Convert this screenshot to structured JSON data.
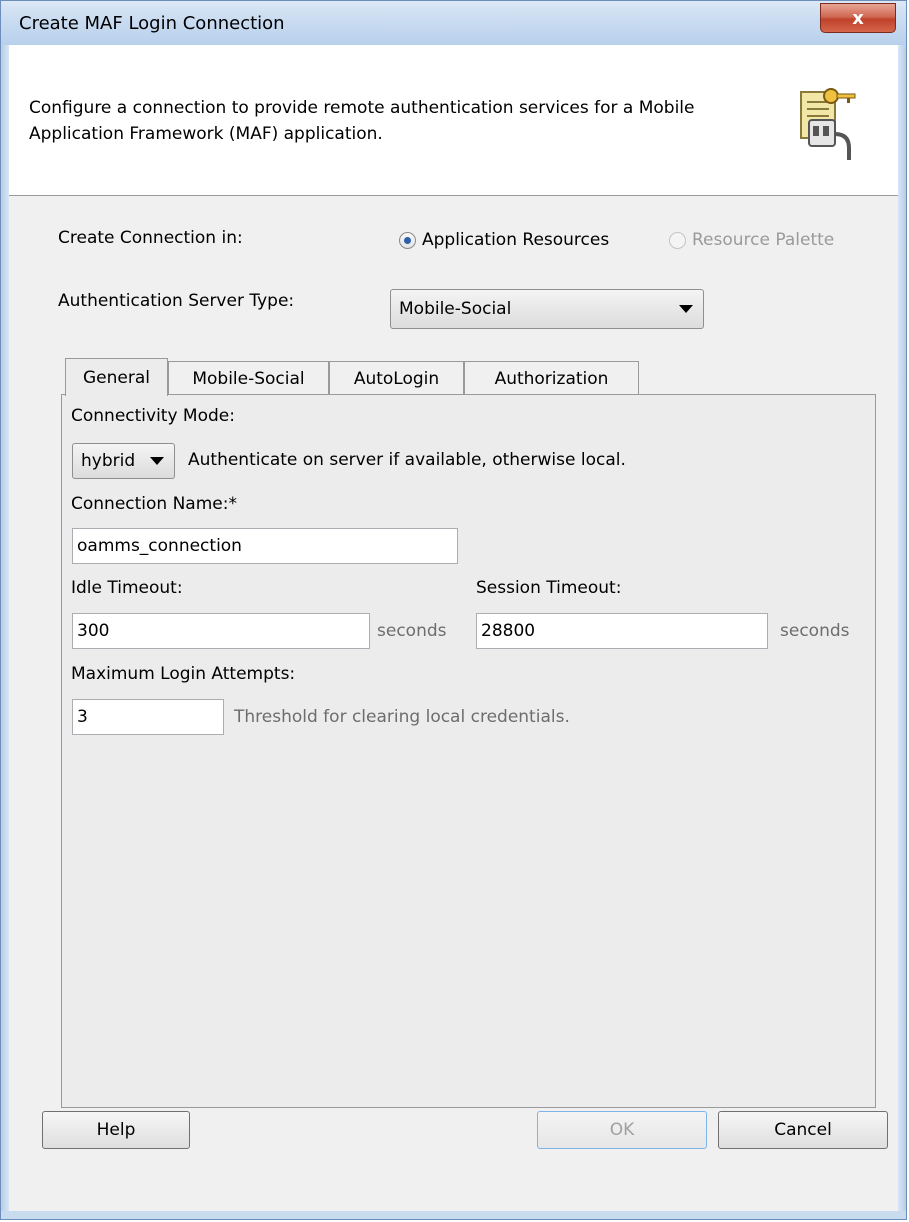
{
  "window": {
    "title": "Create MAF Login Connection",
    "close_label": "x"
  },
  "header": {
    "description": "Configure a connection to provide remote authentication services for a Mobile Application Framework (MAF) application.",
    "icon": "connection-key-icon"
  },
  "create_in": {
    "label": "Create Connection in:",
    "options": [
      {
        "label": "Application Resources",
        "selected": true,
        "enabled": true
      },
      {
        "label": "Resource Palette",
        "selected": false,
        "enabled": false
      }
    ]
  },
  "server_type": {
    "label": "Authentication Server Type:",
    "value": "Mobile-Social"
  },
  "tabs": [
    {
      "label": "General",
      "active": true
    },
    {
      "label": "Mobile-Social",
      "active": false
    },
    {
      "label": "AutoLogin",
      "active": false
    },
    {
      "label": "Authorization",
      "active": false
    }
  ],
  "general": {
    "connectivity_label": "Connectivity Mode:",
    "connectivity_value": "hybrid",
    "connectivity_hint": "Authenticate on server if available, otherwise local.",
    "connection_name_label": "Connection Name:*",
    "connection_name_value": "oamms_connection",
    "idle_timeout_label": "Idle Timeout:",
    "idle_timeout_value": "300",
    "idle_timeout_unit": "seconds",
    "session_timeout_label": "Session Timeout:",
    "session_timeout_value": "28800",
    "session_timeout_unit": "seconds",
    "max_attempts_label": "Maximum Login Attempts:",
    "max_attempts_value": "3",
    "max_attempts_hint": "Threshold for clearing local credentials."
  },
  "buttons": {
    "help": "Help",
    "ok": "OK",
    "cancel": "Cancel"
  }
}
